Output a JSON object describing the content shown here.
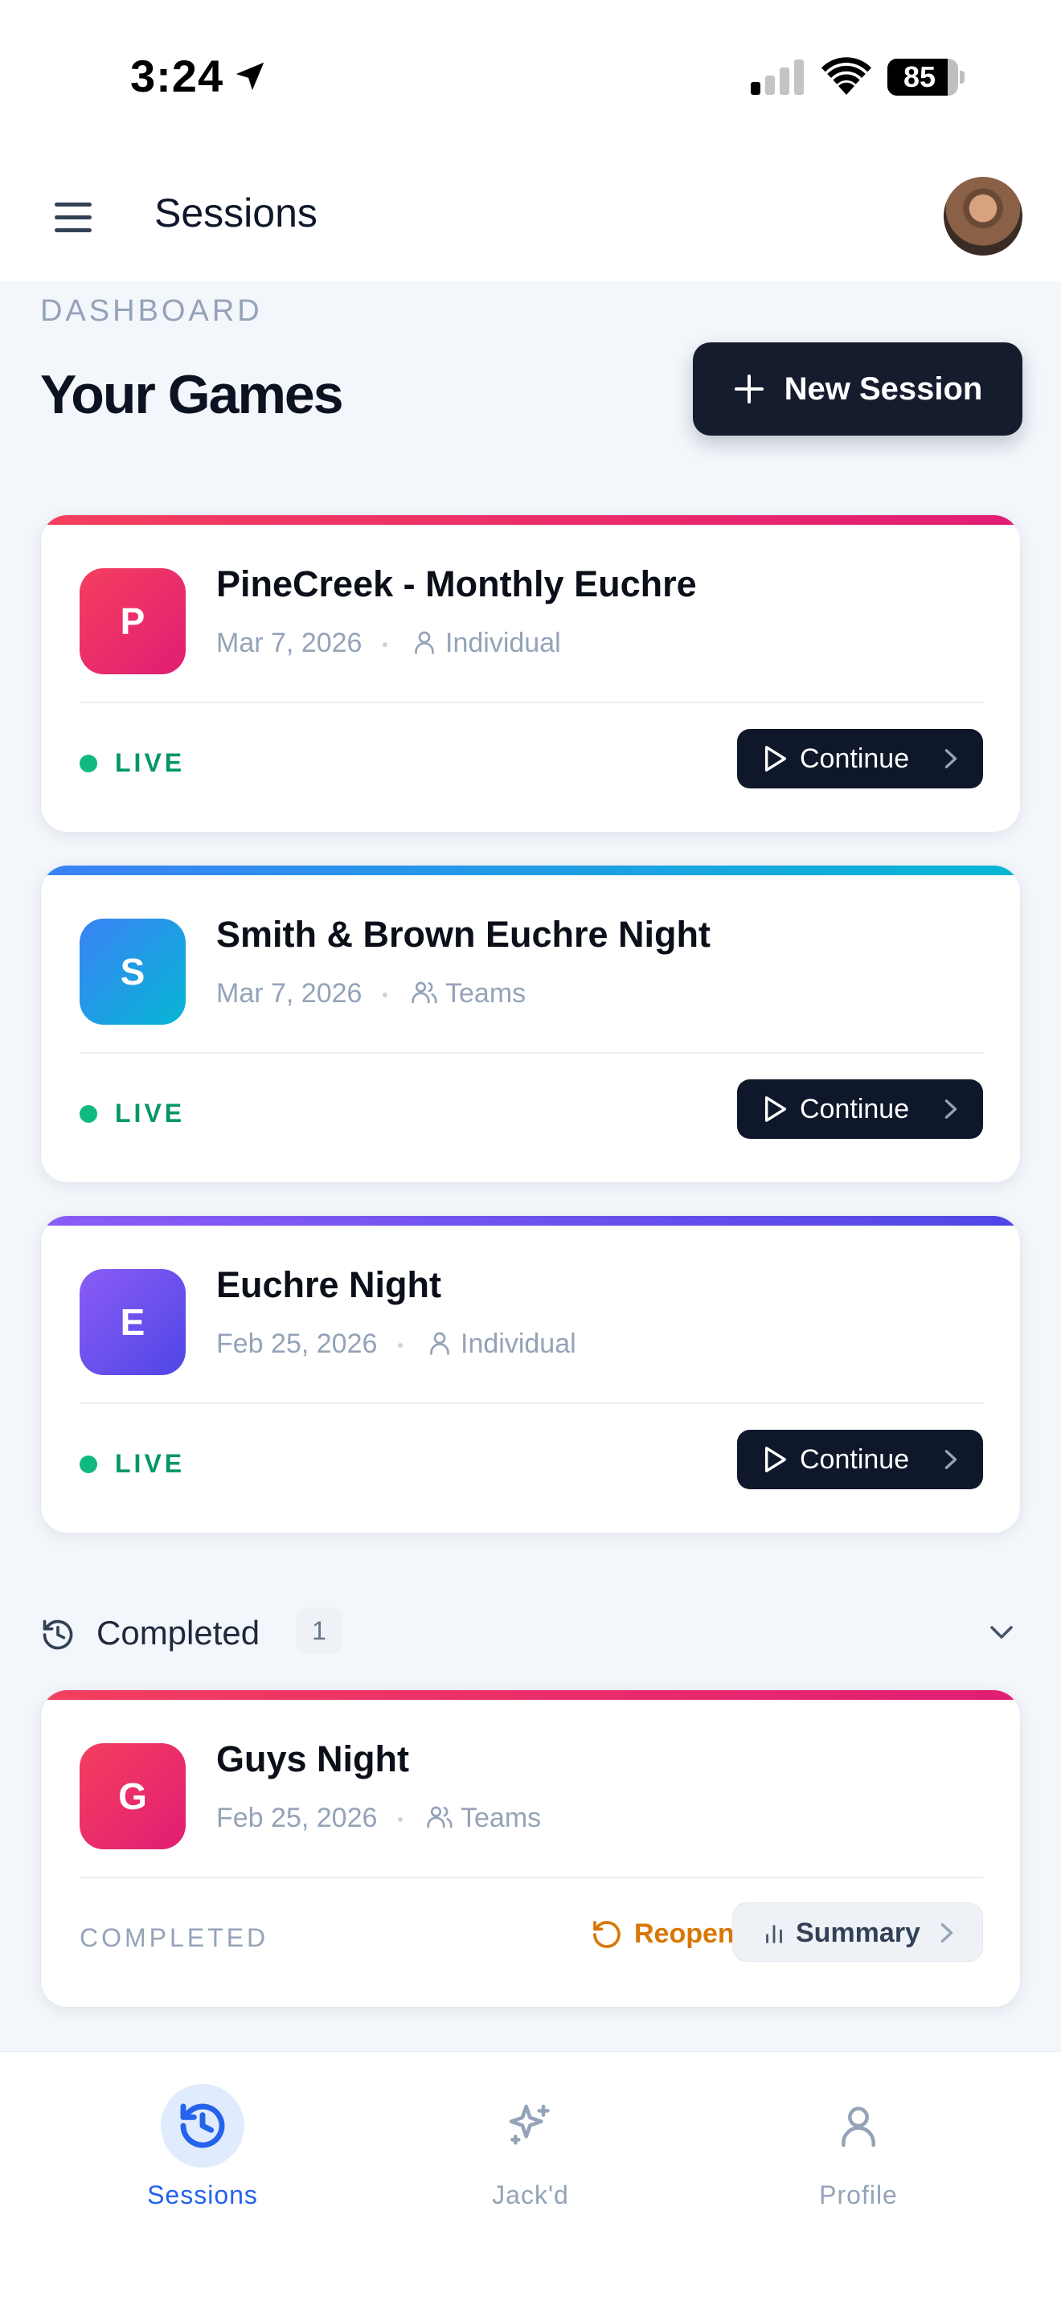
{
  "status_bar": {
    "time": "3:24",
    "battery_percent": 85,
    "battery_label": "85"
  },
  "header": {
    "title": "Sessions"
  },
  "dashboard": {
    "eyebrow": "DASHBOARD",
    "title": "Your Games",
    "new_session_label": "New Session"
  },
  "active_sessions": [
    {
      "initial": "P",
      "title": "PineCreek - Monthly Euchre",
      "date": "Mar 7, 2026",
      "type": "Individual",
      "status": "LIVE",
      "action_label": "Continue",
      "accent_from": "#f43f5e",
      "accent_to": "#e11d74"
    },
    {
      "initial": "S",
      "title": "Smith & Brown Euchre Night",
      "date": "Mar 7, 2026",
      "type": "Teams",
      "status": "LIVE",
      "action_label": "Continue",
      "accent_from": "#3b82f6",
      "accent_to": "#06b6d4"
    },
    {
      "initial": "E",
      "title": "Euchre Night",
      "date": "Feb 25, 2026",
      "type": "Individual",
      "status": "LIVE",
      "action_label": "Continue",
      "accent_from": "#8b5cf6",
      "accent_to": "#4f46e5"
    }
  ],
  "completed": {
    "label": "Completed",
    "count": "1",
    "sessions": [
      {
        "initial": "G",
        "title": "Guys Night",
        "date": "Feb 25, 2026",
        "type": "Teams",
        "status": "COMPLETED",
        "reopen_label": "Reopen",
        "summary_label": "Summary",
        "accent_from": "#f43f5e",
        "accent_to": "#e11d74"
      }
    ]
  },
  "bottom_nav": {
    "items": [
      {
        "label": "Sessions",
        "icon": "history-icon",
        "active": true
      },
      {
        "label": "Jack'd",
        "icon": "sparkles-icon",
        "active": false
      },
      {
        "label": "Profile",
        "icon": "user-icon",
        "active": false
      }
    ]
  },
  "colors": {
    "live": "#10b981",
    "reopen": "#d97706",
    "nav_active": "#2563eb",
    "nav_inactive": "#94a3b8",
    "primary_dark": "#141c2e"
  }
}
